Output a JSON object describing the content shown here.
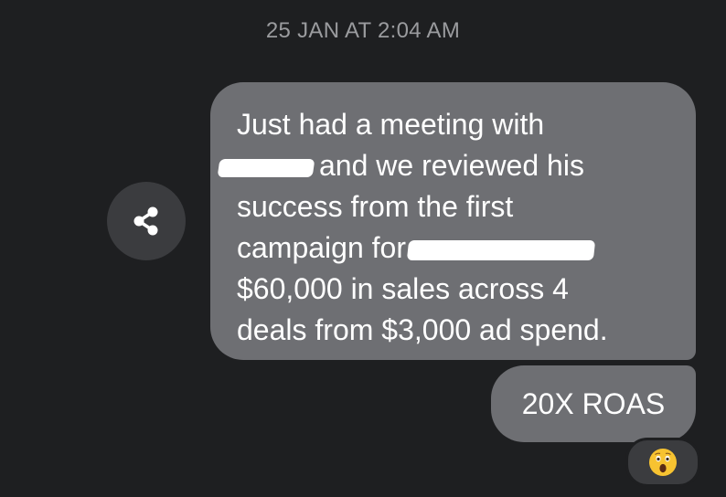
{
  "conversation": {
    "timestamp": "25 JAN AT 2:04 AM"
  },
  "share_button": {
    "icon": "share-icon"
  },
  "message_main": {
    "lines": [
      "Just had a meeting with",
      "and we reviewed his",
      "success from the first",
      "campaign for",
      "$60,000 in sales across 4",
      "deals from $3,000 ad spend."
    ]
  },
  "message_reply": {
    "text": "20X ROAS"
  },
  "reaction": {
    "icon": "astonished-face-emoji"
  },
  "colors": {
    "background": "#1e1f21",
    "bubble": "#6e6f73",
    "share_button": "#3b3c3f",
    "timestamp_text": "#9a9b9e",
    "message_text": "#ffffff"
  }
}
